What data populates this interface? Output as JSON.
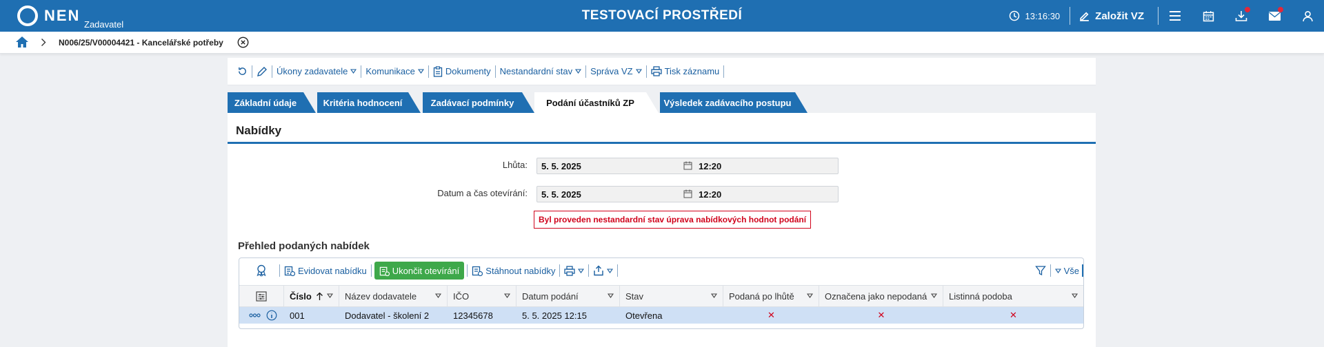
{
  "header": {
    "logo_text": "NEN",
    "logo_sub": "Zadavatel",
    "env_title": "TESTOVACÍ PROSTŘEDÍ",
    "clock": "13:16:30",
    "create_label": "Založit VZ"
  },
  "breadcrumb": {
    "text": "N006/25/V00004421 - Kancelářské potřeby"
  },
  "actions": {
    "ukony": "Úkony zadavatele",
    "komunikace": "Komunikace",
    "dokumenty": "Dokumenty",
    "nestandardni": "Nestandardní stav",
    "sprava": "Správa VZ",
    "tisk": "Tisk záznamu"
  },
  "tabs": [
    {
      "label": "Základní údaje"
    },
    {
      "label": "Kritéria hodnocení"
    },
    {
      "label": "Zadávací podmínky"
    },
    {
      "label": "Podání účastníků ZP"
    },
    {
      "label": "Výsledek zadávacího postupu"
    }
  ],
  "section": {
    "title": "Nabídky",
    "lhuta_label": "Lhůta:",
    "lhuta_date": "5. 5. 2025",
    "lhuta_time": "12:20",
    "otevirani_label": "Datum a čas otevírání:",
    "otevirani_date": "5. 5. 2025",
    "otevirani_time": "12:20",
    "warning": "Byl proveden nestandardní stav úprava nabídkových hodnot podání"
  },
  "grid": {
    "title": "Přehled podaných nabídek",
    "evidovat": "Evidovat nabídku",
    "ukoncit": "Ukončit otevírání",
    "stahnout": "Stáhnout nabídky",
    "filter_all": "Vše",
    "columns": {
      "cislo": "Číslo",
      "nazev": "Název dodavatele",
      "ico": "IČO",
      "datum": "Datum podání",
      "stav": "Stav",
      "po_lhute": "Podaná po lhůtě",
      "nepodana": "Označena jako nepodaná",
      "listinna": "Listinná podoba"
    },
    "rows": [
      {
        "cislo": "001",
        "nazev": "Dodavatel - školení 2",
        "ico": "12345678",
        "datum": "5. 5. 2025 12:15",
        "stav": "Otevřena",
        "po_lhute": "✕",
        "nepodana": "✕",
        "listinna": "✕"
      }
    ]
  },
  "colors": {
    "brand": "#1f6fb2",
    "success": "#3ea84a",
    "danger": "#d0021b"
  }
}
